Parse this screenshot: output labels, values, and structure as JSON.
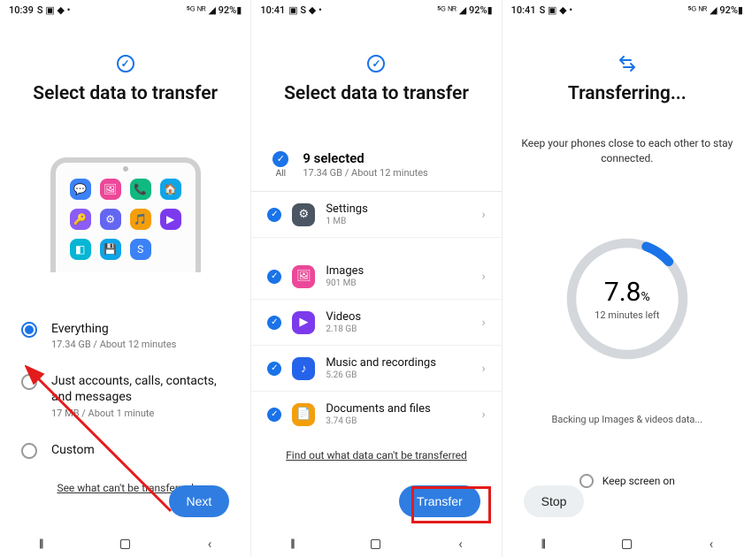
{
  "colors": {
    "primary": "#1a73e8",
    "highlight": "#e31b1b"
  },
  "status": [
    {
      "time": "10:39",
      "icons": "S ▣ ◆ •",
      "signal": "⁵ᴳ ᴺᴿ ◢ 92%▮"
    },
    {
      "time": "10:41",
      "icons": "▣ S ◆ •",
      "signal": "⁵ᴳ ᴺᴿ ◢ 92%▮"
    },
    {
      "time": "10:41",
      "icons": "S ▣ ◆ •",
      "signal": "⁵ᴳ ᴺᴿ ◢ 92%▮"
    }
  ],
  "screen1": {
    "title": "Select data to transfer",
    "options": [
      {
        "label": "Everything",
        "sub": "17.34 GB / About 12 minutes",
        "selected": true
      },
      {
        "label": "Just accounts, calls, contacts, and messages",
        "sub": "17 MB / About 1 minute",
        "selected": false
      },
      {
        "label": "Custom",
        "sub": "",
        "selected": false
      }
    ],
    "app_icons": [
      {
        "bg": "#3b82f6",
        "g": "💬"
      },
      {
        "bg": "#ec4899",
        "g": "🖼"
      },
      {
        "bg": "#10b981",
        "g": "📞"
      },
      {
        "bg": "#0ea5e9",
        "g": "🏠"
      },
      {
        "bg": "#8b5cf6",
        "g": "🔑"
      },
      {
        "bg": "#6366f1",
        "g": "⚙"
      },
      {
        "bg": "#f59e0b",
        "g": "🎵"
      },
      {
        "bg": "#7c3aed",
        "g": "▶"
      },
      {
        "bg": "#06b6d4",
        "g": "◧"
      },
      {
        "bg": "#0ea5e9",
        "g": "💾"
      },
      {
        "bg": "#3b82f6",
        "g": "S"
      }
    ],
    "link": "See what can't be transferred",
    "button": "Next"
  },
  "screen2": {
    "title": "Select data to transfer",
    "all_label": "All",
    "selected_title": "9 selected",
    "selected_sub": "17.34 GB / About 12 minutes",
    "rows": [
      {
        "icon_bg": "#4b5563",
        "icon": "⚙",
        "title": "Settings",
        "sub": "1 MB"
      },
      {
        "icon_bg": "#ec4899",
        "icon": "🖼",
        "title": "Images",
        "sub": "901 MB"
      },
      {
        "icon_bg": "#7c3aed",
        "icon": "▶",
        "title": "Videos",
        "sub": "2.18 GB"
      },
      {
        "icon_bg": "#2563eb",
        "icon": "♪",
        "title": "Music and recordings",
        "sub": "5.26 GB"
      },
      {
        "icon_bg": "#f59e0b",
        "icon": "📄",
        "title": "Documents and files",
        "sub": "3.74 GB"
      }
    ],
    "link": "Find out what data can't be transferred",
    "button": "Transfer"
  },
  "screen3": {
    "title": "Transferring...",
    "subtitle": "Keep your phones close to each other to stay connected.",
    "progress_value": "7.8",
    "progress_unit": "%",
    "progress_sub": "12 minutes left",
    "backing": "Backing up Images & videos data...",
    "keep_label": "Keep screen on",
    "stop": "Stop"
  }
}
